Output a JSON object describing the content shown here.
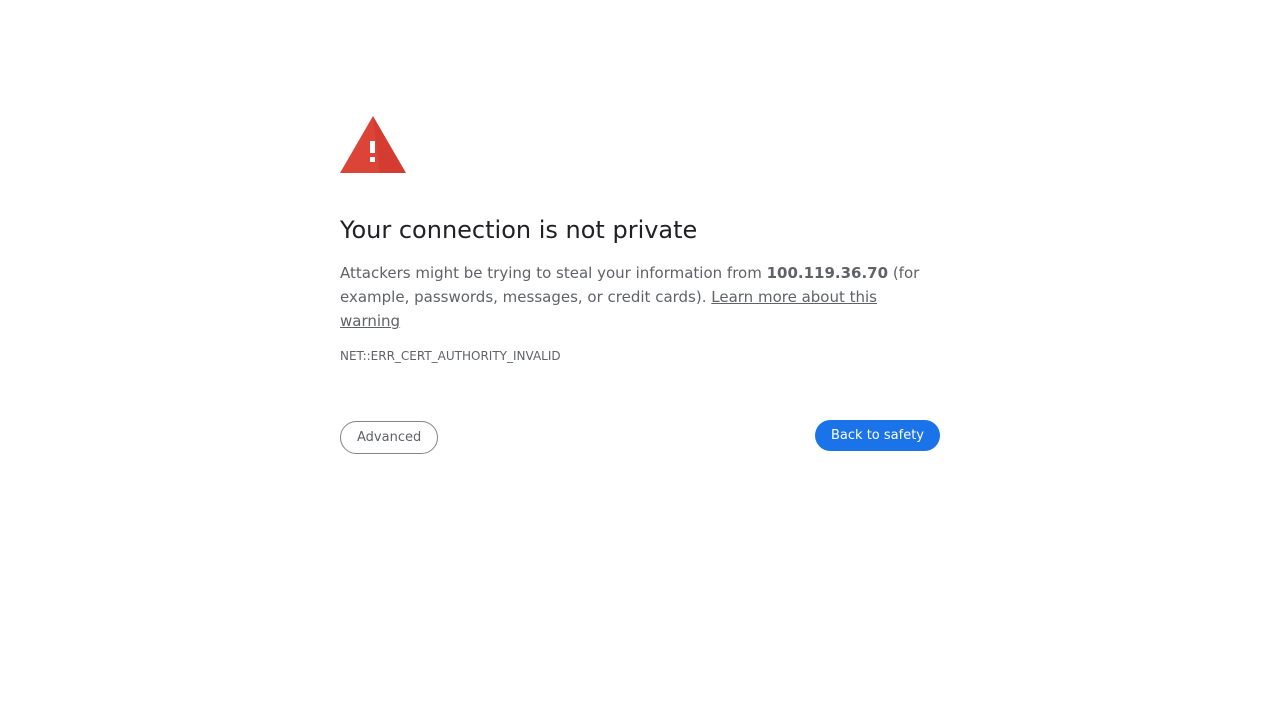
{
  "icon": {
    "name": "warning-triangle-icon",
    "color": "#db4437"
  },
  "heading": "Your connection is not private",
  "message": {
    "prefix": "Attackers might be trying to steal your information from ",
    "host": "100.119.36.70",
    "suffix": " (for example, passwords, messages, or credit cards). ",
    "learn_more": "Learn more about this warning"
  },
  "error_code": "NET::ERR_CERT_AUTHORITY_INVALID",
  "buttons": {
    "advanced": "Advanced",
    "back_to_safety": "Back to safety"
  },
  "colors": {
    "primary": "#1a73e8",
    "heading": "#202124",
    "body": "#5f6368"
  }
}
